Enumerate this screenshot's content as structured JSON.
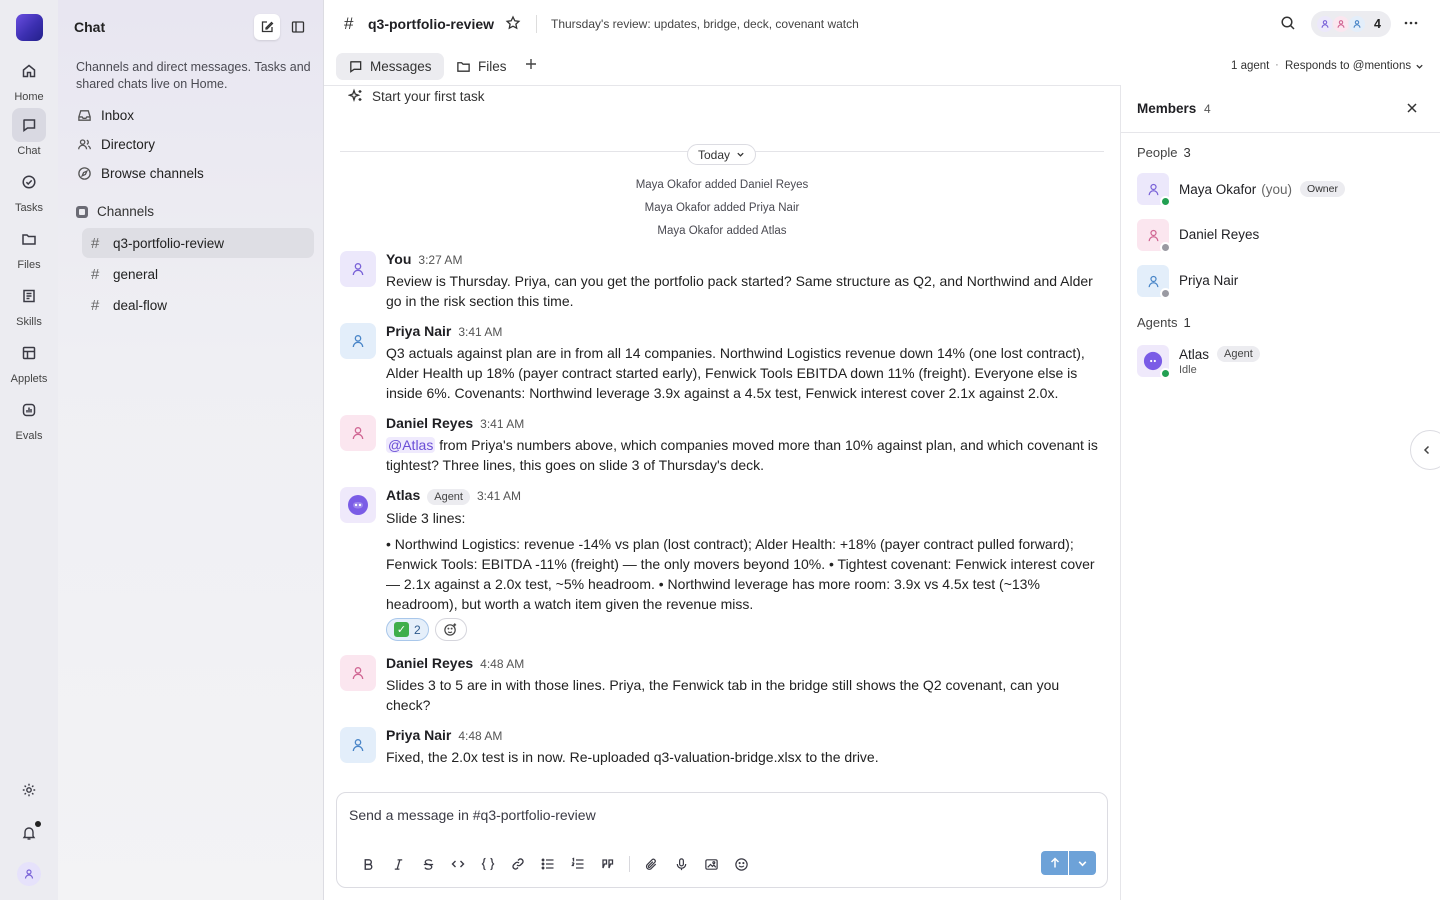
{
  "colors": {
    "accent": "#6a4ed6",
    "send": "#6da2d8",
    "online": "#22a052",
    "offline": "#9a9aa2"
  },
  "rail": {
    "items": [
      {
        "label": "Home",
        "icon": "home-icon"
      },
      {
        "label": "Chat",
        "icon": "chat-icon"
      },
      {
        "label": "Tasks",
        "icon": "tasks-icon"
      },
      {
        "label": "Files",
        "icon": "folder-icon"
      },
      {
        "label": "Skills",
        "icon": "skills-icon"
      },
      {
        "label": "Applets",
        "icon": "applets-icon"
      },
      {
        "label": "Evals",
        "icon": "evals-icon"
      }
    ],
    "active": "Chat"
  },
  "sidebar": {
    "title": "Chat",
    "description": "Channels and direct messages. Tasks and shared chats live on Home.",
    "nav": [
      {
        "label": "Inbox",
        "icon": "inbox-icon"
      },
      {
        "label": "Directory",
        "icon": "users-icon"
      },
      {
        "label": "Browse channels",
        "icon": "compass-icon"
      }
    ],
    "channels_label": "Channels",
    "channels": [
      "q3-portfolio-review",
      "general",
      "deal-flow"
    ],
    "active_channel": "q3-portfolio-review"
  },
  "header": {
    "channel": "q3-portfolio-review",
    "topic": "Thursday's review: updates, bridge, deck, covenant watch",
    "member_count": "4",
    "agent_count": "1 agent",
    "responds": "Responds to @mentions",
    "tabs": [
      {
        "label": "Messages"
      },
      {
        "label": "Files"
      }
    ]
  },
  "feed": {
    "first_task": "Start your first task",
    "date_pill": "Today",
    "system": [
      "Maya Okafor added Daniel Reyes",
      "Maya Okafor added Priya Nair",
      "Maya Okafor added Atlas"
    ],
    "messages": [
      {
        "name": "You",
        "time": "3:27 AM",
        "text": "Review is Thursday. Priya, can you get the portfolio pack started? Same structure as Q2, and Northwind and Alder go in the risk section this time."
      },
      {
        "name": "Priya Nair",
        "time": "3:41 AM",
        "text": "Q3 actuals against plan are in from all 14 companies. Northwind Logistics revenue down 14% (one lost contract), Alder Health up 18% (payer contract started early), Fenwick Tools EBITDA down 11% (freight). Everyone else is inside 6%. Covenants: Northwind leverage 3.9x against a 4.5x test, Fenwick interest cover 2.1x against 2.0x."
      },
      {
        "name": "Daniel Reyes",
        "time": "3:41 AM",
        "mention": "@Atlas",
        "text": " from Priya's numbers above, which companies moved more than 10% against plan, and which covenant is tightest? Three lines, this goes on slide 3 of Thursday's deck."
      },
      {
        "name": "Atlas",
        "badge": "Agent",
        "time": "3:41 AM",
        "intro": "Slide 3 lines:",
        "text": "• Northwind Logistics: revenue -14% vs plan (lost contract); Alder Health: +18% (payer contract pulled forward); Fenwick Tools: EBITDA -11% (freight) — the only movers beyond 10%. • Tightest covenant: Fenwick interest cover — 2.1x against a 2.0x test, ~5% headroom. • Northwind leverage has more room: 3.9x vs 4.5x test (~13% headroom), but worth a watch item given the revenue miss.",
        "reaction_count": "2"
      },
      {
        "name": "Daniel Reyes",
        "time": "4:48 AM",
        "text": "Slides 3 to 5 are in with those lines. Priya, the Fenwick tab in the bridge still shows the Q2 covenant, can you check?"
      },
      {
        "name": "Priya Nair",
        "time": "4:48 AM",
        "text": "Fixed, the 2.0x test is in now. Re-uploaded q3-valuation-bridge.xlsx to the drive."
      }
    ]
  },
  "composer": {
    "placeholder": "Send a message in #q3-portfolio-review"
  },
  "members": {
    "title": "Members",
    "count": "4",
    "people_label": "People",
    "people_count": "3",
    "people": [
      {
        "name": "Maya Okafor",
        "you": "(you)",
        "badge": "Owner",
        "status": "online"
      },
      {
        "name": "Daniel Reyes",
        "status": "offline"
      },
      {
        "name": "Priya Nair",
        "status": "offline"
      }
    ],
    "agents_label": "Agents",
    "agents_count": "1",
    "agents": [
      {
        "name": "Atlas",
        "badge": "Agent",
        "status": "Idle"
      }
    ]
  }
}
